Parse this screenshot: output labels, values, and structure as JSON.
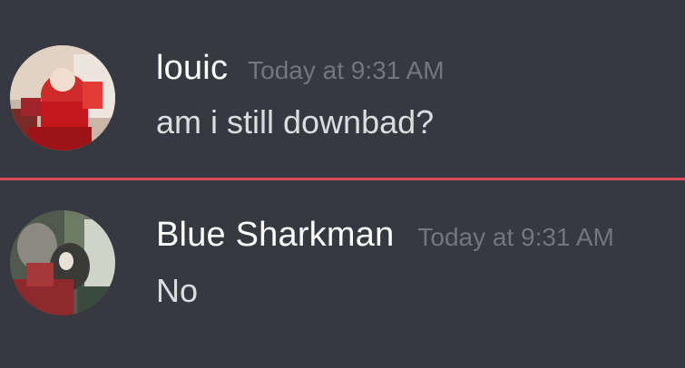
{
  "messages": [
    {
      "username": "louic",
      "timestamp": "Today at 9:31 AM",
      "text": "am i still downbad?",
      "avatar": "avatar-red-figure"
    },
    {
      "username": "Blue Sharkman",
      "timestamp": "Today at 9:31 AM",
      "text": "No",
      "avatar": "avatar-character-close-up"
    }
  ],
  "colors": {
    "background": "#36393f",
    "username": "#ffffff",
    "timestamp": "#72767d",
    "message_text": "#dcddde",
    "new_messages_divider": "#d84c57"
  }
}
